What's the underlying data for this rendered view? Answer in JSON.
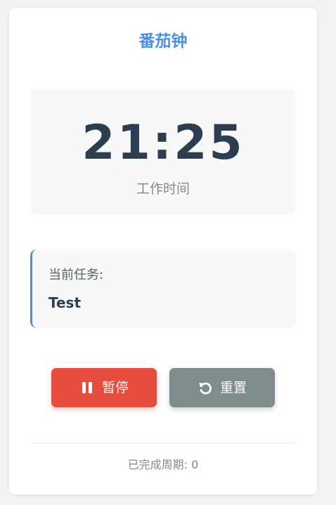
{
  "app": {
    "title": "番茄钟"
  },
  "timer": {
    "time": "21:25",
    "mode": "工作时间"
  },
  "task": {
    "label": "当前任务:",
    "name": "Test"
  },
  "controls": {
    "pause_label": "暂停",
    "reset_label": "重置",
    "pause_icon": "pause-icon",
    "reset_icon": "reset-icon"
  },
  "stats": {
    "label": "已完成周期:",
    "count": "0"
  },
  "colors": {
    "accent": "#4a90e2",
    "pause": "#e74c3c",
    "reset": "#7f8c8d",
    "time_text": "#2c3e50"
  }
}
